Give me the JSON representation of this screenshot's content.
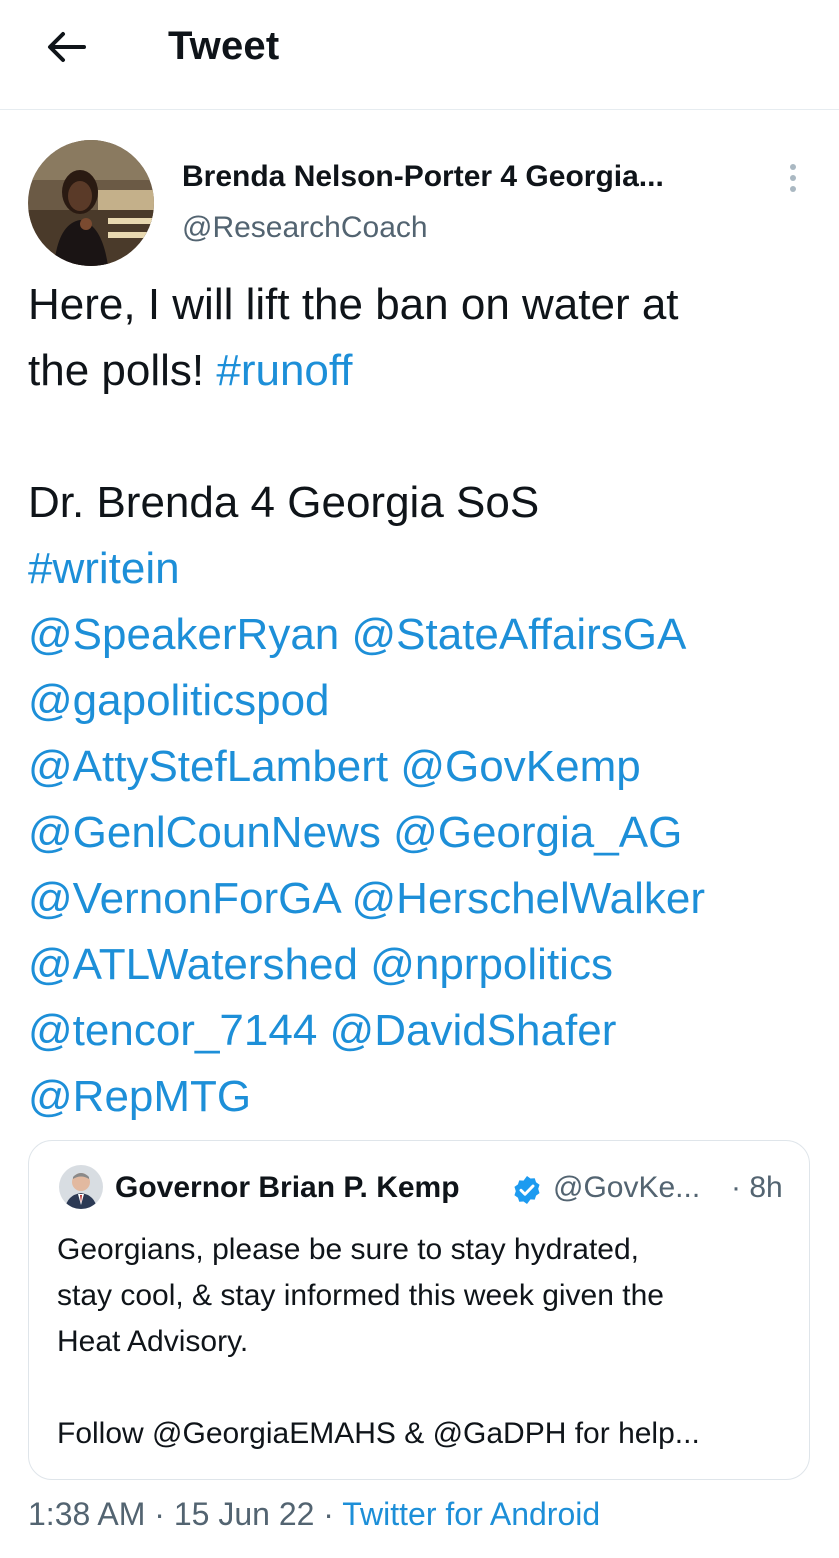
{
  "header": {
    "title": "Tweet"
  },
  "author": {
    "name": "Brenda Nelson-Porter 4 Georgia...",
    "handle": "@ResearchCoach"
  },
  "tweet": {
    "line1": "Here, I will lift the ban on water at",
    "line2_text": "the polls! ",
    "line2_tag": "#runoff",
    "line3": "Dr. Brenda 4 Georgia SoS",
    "tag_writein": "#writein",
    "mentions": [
      [
        "@SpeakerRyan",
        "@StateAffairsGA"
      ],
      [
        "@gapoliticspod"
      ],
      [
        "@AttyStefLambert",
        "@GovKemp"
      ],
      [
        "@GenlCounNews",
        "@Georgia_AG"
      ],
      [
        "@VernonForGA",
        "@HerschelWalker"
      ],
      [
        "@ATLWatershed",
        "@nprpolitics"
      ],
      [
        "@tencor_7144",
        "@DavidShafer"
      ],
      [
        "@RepMTG"
      ]
    ]
  },
  "quote": {
    "name": "Governor Brian P. Kemp",
    "handle": "@GovKe...",
    "time": "· 8h",
    "line1": "Georgians, please be sure to stay hydrated,",
    "line2": "stay cool, & stay informed this week given the",
    "line3": "Heat Advisory.",
    "line4": "Follow @GeorgiaEMAHS & @GaDPH for help..."
  },
  "meta": {
    "time": "1:38 AM",
    "date": "15 Jun 22",
    "separator": " · ",
    "source": "Twitter for Android"
  },
  "colors": {
    "link": "#1d8fd8",
    "secondary": "#536471",
    "verified": "#1d9bf0"
  }
}
